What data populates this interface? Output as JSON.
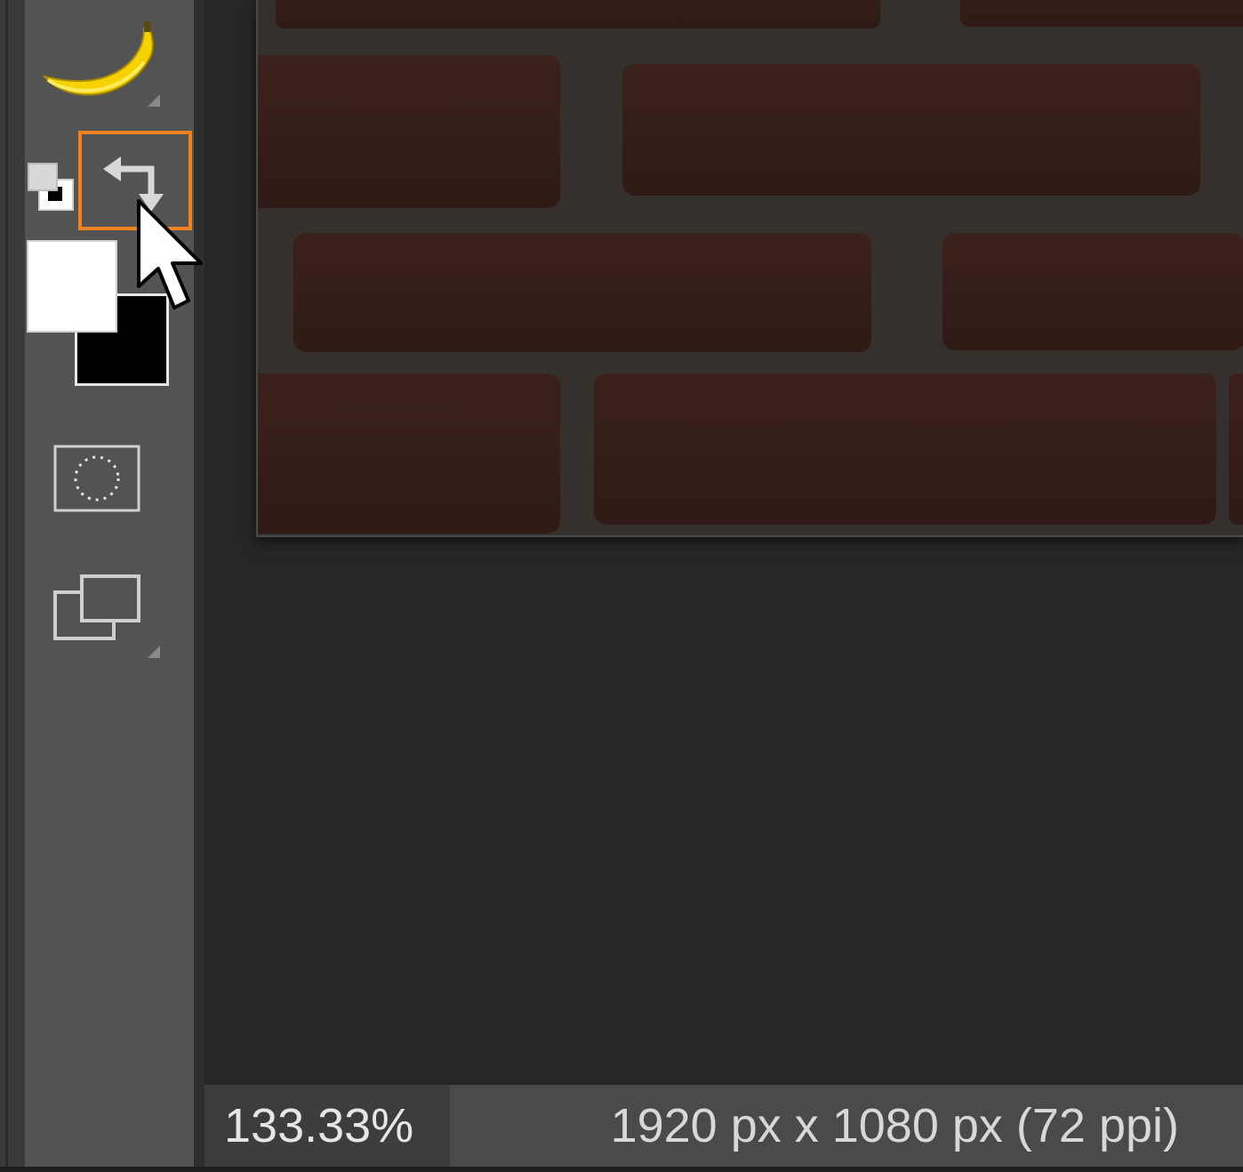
{
  "toolbar": {
    "tools": [
      {
        "name": "banana",
        "icon": "banana-icon"
      },
      {
        "name": "default-colors",
        "icon": "default-colors-icon"
      },
      {
        "name": "swap-colors",
        "icon": "swap-colors-icon",
        "highlighted": true
      },
      {
        "name": "foreground-color",
        "value": "#ffffff"
      },
      {
        "name": "background-color",
        "value": "#000000"
      },
      {
        "name": "quick-mask",
        "icon": "quick-mask-icon"
      },
      {
        "name": "screen-mode",
        "icon": "screen-mode-icon"
      }
    ],
    "highlight_color": "#f58220"
  },
  "canvas": {
    "image": "brick-wall"
  },
  "status": {
    "zoom": "133.33%",
    "doc_info": "1920 px x 1080 px (72 ppi)"
  }
}
